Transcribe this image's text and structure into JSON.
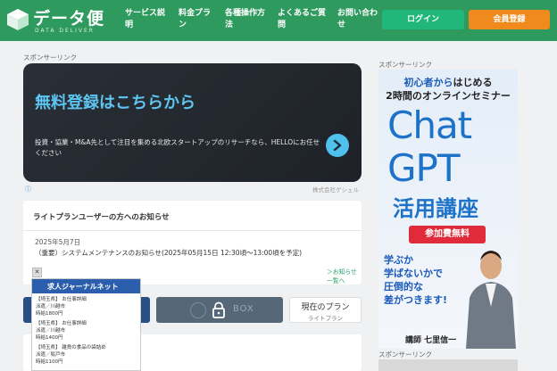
{
  "header": {
    "logo_text": "データ便",
    "logo_sub": "DATA DELIVER",
    "nav": [
      {
        "label": "サービス説\n明"
      },
      {
        "label": "料金プラ\nン"
      },
      {
        "label": "各種操作方\n法"
      },
      {
        "label": "よくあるご質\n問"
      },
      {
        "label": "お問い合わ\nせ"
      }
    ],
    "login_label": "ログイン",
    "register_label": "会員登録",
    "colors": {
      "bar": "#2e9a5e",
      "login": "#22b77a",
      "register": "#f08a1c"
    }
  },
  "sponsor_label": "スポンサーリンク",
  "main_ad": {
    "title": "無料登録はこちらから",
    "desc": "投資・協業・M&A先として注目を集める北欧スタートアップのリサーチなら、HELLOにお任せください",
    "advertiser": "株式会社ゲシェル",
    "adchoice": "ⓘ"
  },
  "notice": {
    "title": "ライトプランユーザーの方へのお知らせ",
    "date": "2025年5月7日",
    "message": "（重要）システムメンテナンスのお知らせ(2025年05月15日 12:30頃〜13:00頃を予定)",
    "link": "＞お知らせ一覧へ"
  },
  "buttons": {
    "sandbox": "BOX",
    "plan_title": "現在のプラン",
    "plan_sub": "ライトプラン"
  },
  "job_ad": {
    "close": "✕",
    "header": "求人ジャーナルネット",
    "listings": [
      {
        "l1": "【埼玉県】 お仕事詳細",
        "l2": "派遣／川越市",
        "l3": "時給1800円"
      },
      {
        "l1": "【埼玉県】 お仕事詳細",
        "l2": "派遣／川越市",
        "l3": "時給1400円"
      },
      {
        "l1": "【埼玉県】 雑貨の食品の袋詰め",
        "l2": "派遣／坂戸市",
        "l3": "時給1100円"
      }
    ]
  },
  "right_ad": {
    "line1_a": "初心者から",
    "line1_b": "はじめる",
    "line2": "2時間のオンラインセミナー",
    "chat": "Chat",
    "gpt": "GPT",
    "course": "活用講座",
    "free": "参加費無料",
    "copy": [
      "学ぶか",
      "学ばないかで",
      "圧倒的な",
      "差がつきます!"
    ],
    "speaker": "講師 七里信一"
  }
}
